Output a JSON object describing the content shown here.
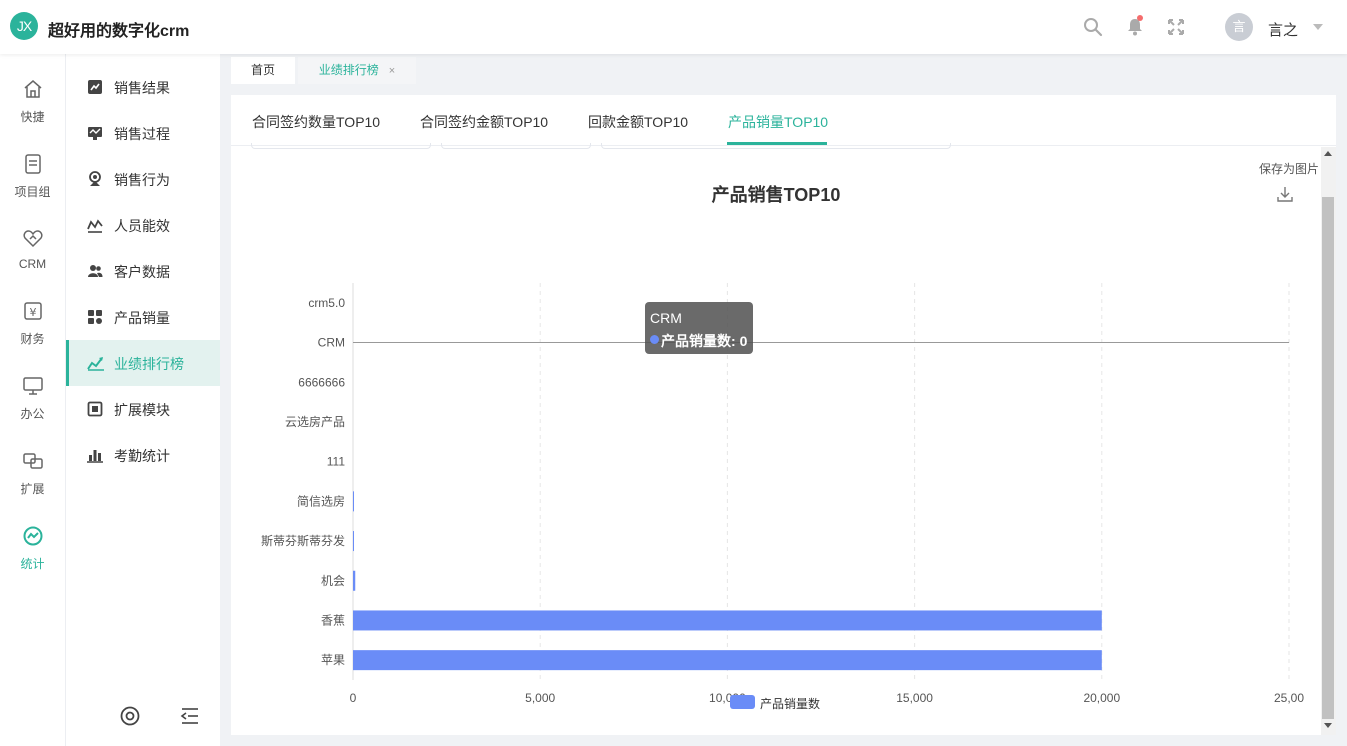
{
  "header": {
    "logo_text": "JX",
    "app_title": "超好用的数字化crm",
    "user": {
      "avatar_text": "言",
      "name": "言之"
    },
    "icons": [
      "search-icon",
      "bell-icon",
      "fullscreen-icon"
    ]
  },
  "rail": {
    "items": [
      {
        "label": "快捷",
        "icon": "home-icon"
      },
      {
        "label": "项目组",
        "icon": "document-icon"
      },
      {
        "label": "CRM",
        "icon": "heart-handshake-icon"
      },
      {
        "label": "财务",
        "icon": "finance-icon"
      },
      {
        "label": "办公",
        "icon": "monitor-icon"
      },
      {
        "label": "扩展",
        "icon": "extend-icon"
      },
      {
        "label": "统计",
        "icon": "stats-icon",
        "active": true
      }
    ]
  },
  "submenu": {
    "items": [
      {
        "label": "销售结果",
        "icon": "sales-result-icon"
      },
      {
        "label": "销售过程",
        "icon": "sales-process-icon"
      },
      {
        "label": "销售行为",
        "icon": "sales-behavior-icon"
      },
      {
        "label": "人员能效",
        "icon": "staff-efficiency-icon"
      },
      {
        "label": "客户数据",
        "icon": "customer-data-icon"
      },
      {
        "label": "产品销量",
        "icon": "product-sales-icon"
      },
      {
        "label": "业绩排行榜",
        "icon": "ranking-icon",
        "active": true
      },
      {
        "label": "扩展模块",
        "icon": "extension-module-icon"
      },
      {
        "label": "考勤统计",
        "icon": "attendance-icon"
      }
    ],
    "bottom_icons": [
      "settings-icon",
      "collapse-menu-icon"
    ]
  },
  "page_tabs": [
    {
      "label": "首页"
    },
    {
      "label": "业绩排行榜",
      "active": true,
      "close": "×"
    }
  ],
  "rank_tabs": [
    {
      "label": "合同签约数量TOP10"
    },
    {
      "label": "合同签约金额TOP10"
    },
    {
      "label": "回款金额TOP10"
    },
    {
      "label": "产品销量TOP10",
      "active": true
    }
  ],
  "toolbox": {
    "save_label": "保存为图片",
    "icon": "download-icon"
  },
  "tooltip": {
    "title": "CRM",
    "series": "产品销量数",
    "value": "0"
  },
  "colors": {
    "accent": "#2bb39b",
    "bar": "#6a8cf7"
  },
  "chart_data": {
    "type": "bar",
    "orientation": "horizontal",
    "title": "产品销售TOP10",
    "categories": [
      "crm5.0",
      "CRM",
      "6666666",
      "云选房产品",
      "111",
      "简信选房",
      "斯蒂芬斯蒂芬发",
      "机会",
      "香蕉",
      "苹果"
    ],
    "series": [
      {
        "name": "产品销量数",
        "values": [
          0,
          0,
          0,
          0,
          0,
          1,
          1,
          60,
          20000,
          20000
        ]
      }
    ],
    "xlim": [
      0,
      25000
    ],
    "xticks": [
      "0",
      "5,000",
      "10,000",
      "15,000",
      "20,000",
      "25,00"
    ],
    "grid": true,
    "legend": "bottom-center",
    "highlighted_category": "CRM"
  }
}
